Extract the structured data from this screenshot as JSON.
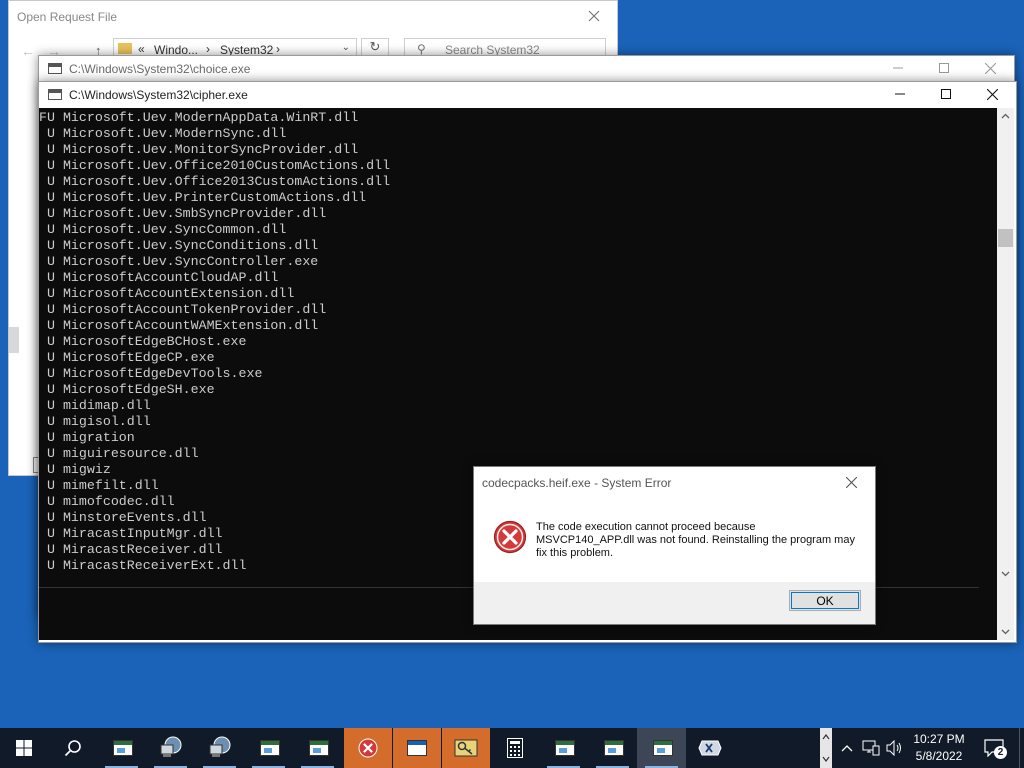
{
  "explorer": {
    "title": "Open Request File",
    "path": [
      "Windo...",
      "System32"
    ],
    "search_placeholder": "Search System32",
    "nav_prefix": "«",
    "path_sep": "›"
  },
  "choice_window": {
    "title": "C:\\Windows\\System32\\choice.exe"
  },
  "cipher_window": {
    "title": "C:\\Windows\\System32\\cipher.exe",
    "lines": [
      "FU Microsoft.Uev.ModernAppData.WinRT.dll",
      " U Microsoft.Uev.ModernSync.dll",
      " U Microsoft.Uev.MonitorSyncProvider.dll",
      " U Microsoft.Uev.Office2010CustomActions.dll",
      " U Microsoft.Uev.Office2013CustomActions.dll",
      " U Microsoft.Uev.PrinterCustomActions.dll",
      " U Microsoft.Uev.SmbSyncProvider.dll",
      " U Microsoft.Uev.SyncCommon.dll",
      " U Microsoft.Uev.SyncConditions.dll",
      " U Microsoft.Uev.SyncController.exe",
      " U MicrosoftAccountCloudAP.dll",
      " U MicrosoftAccountExtension.dll",
      " U MicrosoftAccountTokenProvider.dll",
      " U MicrosoftAccountWAMExtension.dll",
      " U MicrosoftEdgeBCHost.exe",
      " U MicrosoftEdgeCP.exe",
      " U MicrosoftEdgeDevTools.exe",
      " U MicrosoftEdgeSH.exe",
      " U midimap.dll",
      " U migisol.dll",
      " U migration",
      " U miguiresource.dll",
      " U migwiz",
      " U mimefilt.dll",
      " U mimofcodec.dll",
      " U MinstoreEvents.dll",
      " U MiracastInputMgr.dll",
      " U MiracastReceiver.dll",
      " U MiracastReceiverExt.dll"
    ]
  },
  "dialog": {
    "title": "codecpacks.heif.exe - System Error",
    "message": "The code execution cannot proceed because MSVCP140_APP.dll was not found. Reinstalling the program may fix this problem.",
    "ok_label": "OK"
  },
  "taskbar": {
    "time": "10:27 PM",
    "date": "5/8/2022",
    "notification_count": "2",
    "colors": {
      "background": "#101a28",
      "flash": "#d46c2c",
      "active": "#3c4656"
    }
  },
  "icons": [
    "windows-start-icon",
    "search-icon",
    "error-icon",
    "calculator-icon",
    "network-icon",
    "volume-icon",
    "chevron-up-icon",
    "notification-icon"
  ]
}
